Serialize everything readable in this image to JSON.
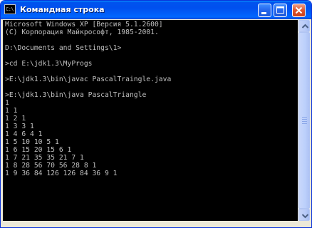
{
  "window": {
    "title": "Командная строка",
    "icon": "console-icon",
    "icon_text": "C:\\",
    "buttons": [
      "minimize-icon",
      "maximize-icon",
      "close-icon"
    ]
  },
  "console": {
    "lines": [
      "Microsoft Windows XP [Версия 5.1.2600]",
      "(С) Корпорация Майкрософт, 1985-2001.",
      "",
      "D:\\Documents and Settings\\1>",
      "",
      ">cd E:\\jdk1.3\\MyProgs",
      "",
      ">E:\\jdk1.3\\bin\\javac PascalTraingle.java",
      "",
      ">E:\\jdk1.3\\bin\\java PascalTriangle",
      "1",
      "1 1",
      "1 2 1",
      "1 3 3 1",
      "1 4 6 4 1",
      "1 5 10 10 5 1",
      "1 6 15 20 15 6 1",
      "1 7 21 35 35 21 7 1",
      "1 8 28 56 70 56 28 8 1",
      "1 9 36 84 126 126 84 36 9 1"
    ]
  },
  "colors": {
    "title_bar": "#0050ee",
    "console_background": "#000000",
    "console_text": "#c0c0c0",
    "close_button": "#e0542b"
  }
}
